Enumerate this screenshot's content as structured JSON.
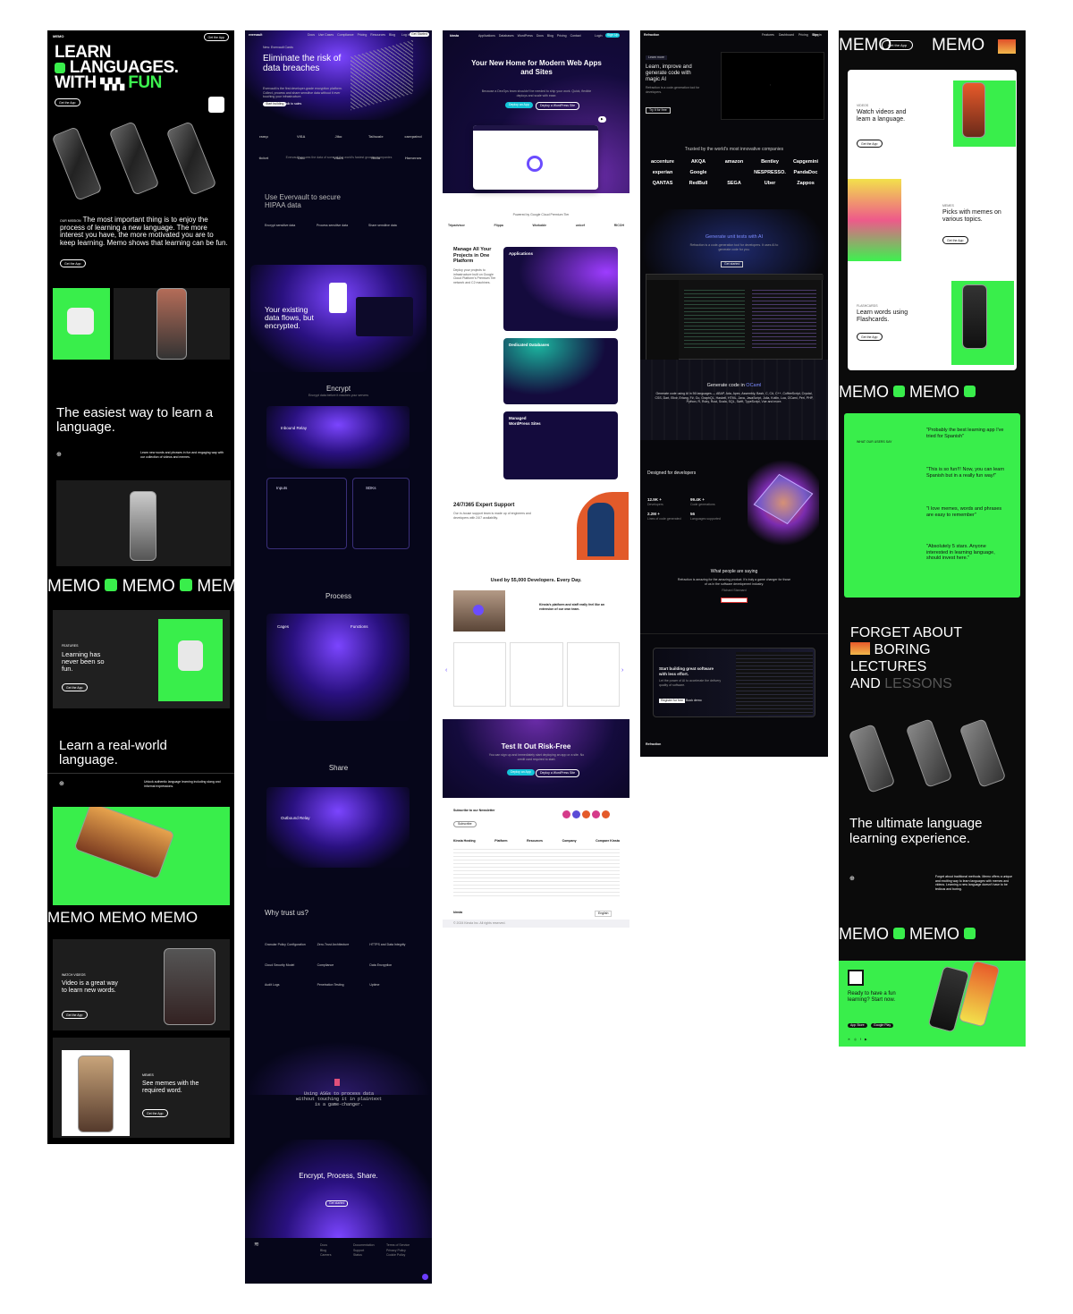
{
  "memo": {
    "brand": "MEMO",
    "get_app": "Get the App",
    "hero_l1": "LEARN",
    "hero_l2": "LANGUAGES.",
    "hero_l3": "WITH",
    "hero_fun": "FUN",
    "hero_btn": "Get the App",
    "intro_label": "OUR MISSION",
    "intro": "The most important thing is to enjoy the process of learning a new language. The more interest you have, the more motivated you are to keep learning. Memo shows that learning can be fun.",
    "intro_btn": "Get the App",
    "easiest": "The easiest way to learn a language.",
    "easiest_sub": "Learn new words and phrases in fun and engaging way with our collection of videos and memes.",
    "ticker": "MEMO",
    "never_label": "FEATURES",
    "never": "Learning has never been so fun.",
    "never_btn": "Get the App",
    "realworld": "Learn a real-world language.",
    "realworld_sub": "Unlock authentic language learning including slang and informal expressions.",
    "video_label": "WATCH VIDEOS",
    "video": "Video is a great way to learn new words.",
    "video_btn": "Get the App",
    "memes_label": "MEMES",
    "memes": "See memes with the required word.",
    "memes_btn": "Get the App"
  },
  "evervault": {
    "brand": "evervault",
    "nav": [
      "Docs",
      "Use Cases",
      "Compliance",
      "Pricing",
      "Resources",
      "Blog"
    ],
    "login": "Log in",
    "signup": "Get Started",
    "badge": "New: Evervault Cards",
    "hero": "Eliminate the risk of data breaches",
    "hero_sub": "Evervault is the first developer-grade encryption platform. Collect, process and share sensitive data without it ever touching your infrastructure.",
    "cta1": "Start building",
    "cta2": "Talk to sales",
    "logos": [
      "ramp",
      "VISA",
      "Jiko",
      "Tailscale",
      "carepatrol",
      "ticket",
      "Onu",
      "Vitani",
      "Hello",
      "Homerow"
    ],
    "logos_sub": "Evervault secures the data of some of the world's fastest growing companies",
    "hipaa": "Use Evervault to secure HIPAA data",
    "features": [
      "Encrypt sensitive data",
      "Process sensitive data",
      "Share sensitive data"
    ],
    "flows": "Your existing data flows, but encrypted.",
    "encrypt": "Encrypt",
    "encrypt_sub": "Encrypt data before it reaches your servers",
    "inbound": "Inbound Relay",
    "inputs": "Inputs",
    "sdks": "SDKs",
    "process": "Process",
    "cages": "Cages",
    "functions": "Functions",
    "share": "Share",
    "outbound": "Outbound Relay",
    "trust": "Why trust us?",
    "trust_items": [
      "Granular Policy Configuration",
      "Zero-Trust Architecture",
      "HTTPS and Data Integrity",
      "Cloud Security Model",
      "Compliance",
      "Data Encryption",
      "Audit Logs",
      "Penetration Testing",
      "Uptime"
    ],
    "code": "Using ASGs to process data without touching it in plaintext is a game-changer.",
    "final": "Encrypt, Process, Share.",
    "final_btn": "Get started",
    "footer_cols": [
      "Docs",
      "Blog",
      "Careers",
      "Security",
      "Documentation",
      "Support",
      "Status",
      "Terms of Service",
      "Privacy Policy",
      "Cookie Policy",
      "SOC 2 Type II"
    ]
  },
  "kinsta": {
    "brand": "kinsta",
    "nav": [
      "Applications",
      "Databases",
      "WordPress",
      "Docs",
      "Blog",
      "Pricing",
      "Contact"
    ],
    "login": "Login",
    "signup": "Sign Up",
    "hero": "Your New Home for Modern Web Apps and Sites",
    "hero_sub": "Because a DevOps team shouldn't be needed to ship your work. Quick, flexible deploys and scale with ease.",
    "cta1": "Deploy an App",
    "cta2": "Deploy a WordPress Site",
    "logos_title": "Powered by Google Cloud Premium Tier",
    "logos": [
      "Tripadvisor",
      "Flippa",
      "Workable",
      "unicef",
      "RICOH"
    ],
    "manage": "Manage All Your Projects in One Platform",
    "manage_sub": "Deploy your projects to infrastructure built on Google Cloud Platform's Premium Tier network and C2 machines.",
    "apps": "Applications",
    "db": "Dedicated Databases",
    "wp": "Managed WordPress Sites",
    "support": "24/7/365 Expert Support",
    "support_sub": "Our in-house support team is made up of engineers and developers with 24/7 availability.",
    "used": "Used by 55,000 Developers. Every Day.",
    "used_sub": "Kinsta's platform and staff really feel like an extension of our own team.",
    "test": "Test It Out Risk-Free",
    "test_sub": "You can sign up and immediately start deploying an app or a site. No credit card required to start.",
    "test_cta1": "Deploy an App",
    "test_cta2": "Deploy a WordPress Site",
    "newsletter": "Subscribe to our Newsletter",
    "news_btn": "Subscribe",
    "footer_cols": [
      "Kinsta Hosting",
      "Platform",
      "Resources",
      "Company",
      "Compare Kinsta"
    ],
    "lang": "English",
    "copyright": "© 2024 Kinsta Inc. All rights reserved."
  },
  "refraction": {
    "brand": "Refraction",
    "nav": [
      "Features",
      "Dashboard",
      "Pricing",
      "Blog"
    ],
    "cta": "Sign in",
    "badge": "Learn more",
    "hero": "Learn, improve and generate code with magic AI",
    "hero_sub": "Refraction is a code-generation tool for developers.",
    "hero_btn": "Try it for free",
    "trusted": "Trusted by the world's most innovative companies",
    "logos": [
      "accenture",
      "AKQA",
      "amazon",
      "Bentley",
      "Capgemini",
      "experian",
      "Google",
      "",
      "NESPRESSO.",
      "PandaDoc",
      "QANTAS",
      "RedBull",
      "SEGA",
      "Uber",
      "Zappos"
    ],
    "unit": "Generate unit tests with AI",
    "unit_sub": "Refraction is a code-generation tool for developers. It uses AI to generate code for you.",
    "unit_btn": "Get started",
    "ocaml_pre": "Generate code in",
    "ocaml": "OCaml",
    "langs": "Generate code using AI in 56 languages — ABAP, Ada, Apex, Assembly, Bash, C, C#, C++, CoffeeScript, Crystal, CSS, Dart, Elixir, Erlang, F#, Go, GraphQL, Haskell, HTML, Java, JavaScript, Julia, Kotlin, Lua, OCaml, Perl, PHP, Python, R, Ruby, Rust, Scala, SQL, Swift, TypeScript, Vue and more.",
    "designed": "Designed for developers",
    "stats": [
      {
        "v": "12.9K +",
        "l": "Developers"
      },
      {
        "v": "99.4K +",
        "l": "Code generations"
      },
      {
        "v": "2.2M +",
        "l": "Lines of code generated"
      },
      {
        "v": "56",
        "l": "Languages supported"
      }
    ],
    "people": "What people are saying",
    "quote": "Refraction is amazing for the amazing product. It's truly a game changer for those of us in the software development industry.",
    "quote_by": "Richard Stannard",
    "cta_box": "Start building great software with less effort.",
    "cta_box_sub": "Let the power of AI to accelerate the delivery quality of software.",
    "cta_btn1": "Register for free",
    "cta_btn2": "Book demo",
    "footer": "Refraction"
  },
  "memo2": {
    "brand": "MEMO",
    "get_app": "Get the App",
    "watch_label": "VIDEOS",
    "watch": "Watch videos and learn a language.",
    "watch_btn": "Get the App",
    "picks_label": "MEMES",
    "picks": "Picks with memes on various topics.",
    "picks_btn": "Get the App",
    "flash_label": "FLASHCARDS",
    "flash": "Learn words using Flashcards.",
    "flash_btn": "Get the App",
    "reviews_label": "WHAT OUR USERS SAY",
    "q1": "\"Probably the best learning app I've tried for Spanish\"",
    "q2": "\"This is so fun!!! Now, you can learn Spanish but in a really fun way!\"",
    "q3": "\"I love memes, words and phrases are easy to remember\"",
    "q4": "\"Absolutely 5 stars. Anyone interested in learning language, should invest here.\"",
    "forget1": "FORGET ABOUT",
    "forget2": "BORING",
    "forget3": "LECTURES",
    "forget4": "AND",
    "forget5": "LESSONS",
    "ultimate": "The ultimate language learning experience.",
    "ultimate_sub": "Forget about traditional methods. Memo offers a unique and exciting way to learn languages with memes and videos. Learning a new language doesn't have to be tedious and boring.",
    "ready": "Ready to have a fun learning? Start now.",
    "ready_btn": "App Store",
    "ready_btn2": "Google Play"
  },
  "colors": {
    "green": "#39ee4b",
    "purple": "#6b3cff",
    "teal": "#13c4d8"
  }
}
